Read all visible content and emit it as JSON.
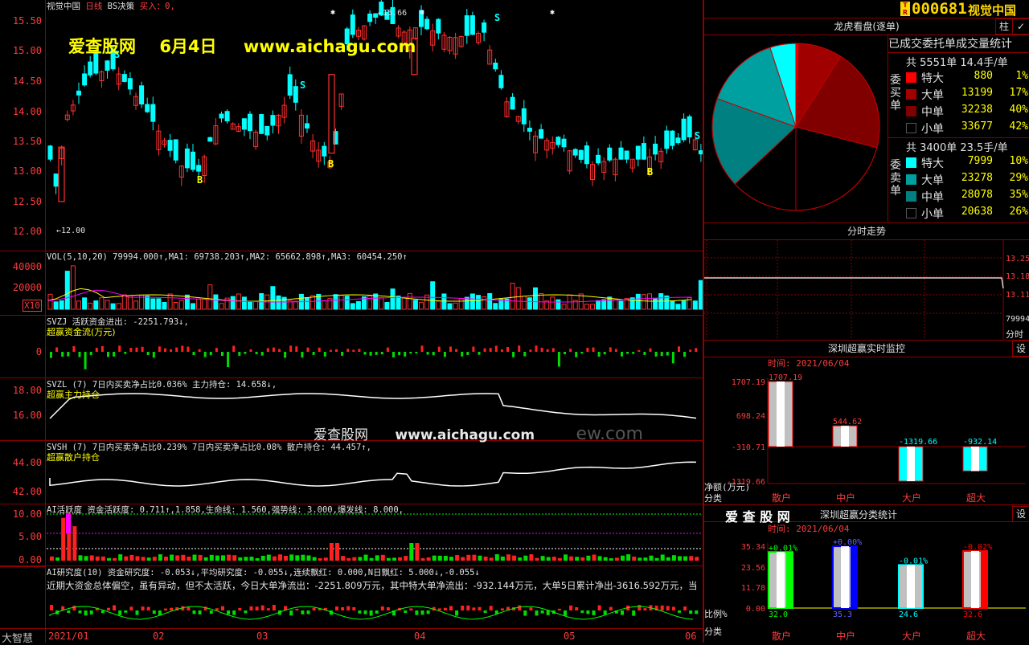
{
  "stock": {
    "code": "000681",
    "name": "视觉中国",
    "flag": "T R"
  },
  "chart_title": {
    "name": "视觉中国",
    "period": "日线",
    "strategy": "BS决策",
    "buy_label": "买入：0,"
  },
  "watermark": {
    "site": "爱查股网",
    "date": "6月4日",
    "url": "www.aichagu.com",
    "center_site": "爱查股网",
    "center_url": "www.aichagu.com",
    "center_tail": "ew.com"
  },
  "price_axis": [
    "15.50",
    "15.00",
    "14.50",
    "14.00",
    "13.50",
    "13.00",
    "12.50",
    "12.00"
  ],
  "price_marks": {
    "high": "15.66",
    "low": "12.00"
  },
  "signals": {
    "buy": "B",
    "sell": "S"
  },
  "vol": {
    "title": "VOL(5,10,20) 79994.000↑,MA1: 69738.203↑,MA2: 65662.898↑,MA3: 60454.250↑",
    "axis": [
      "40000",
      "20000"
    ],
    "unit": "X10"
  },
  "svzj": {
    "title": "SVZJ  活跃资金进出: -2251.793↓,",
    "sub": "超赢资金流(万元)",
    "axis": [
      "0"
    ]
  },
  "svzl": {
    "title": "SVZL (7) 7日内买卖净占比0.036% 主力持仓: 14.658↓,",
    "sub": "超赢主力持仓",
    "axis": [
      "18.00",
      "16.00"
    ]
  },
  "svsh": {
    "title": "SVSH (7) 7日内买卖净占比0.239% 7日内买卖净占比0.08% 散户持仓: 44.457↑,",
    "sub": "超赢散户持仓",
    "axis": [
      "44.00",
      "42.00"
    ]
  },
  "ai_active": {
    "title": "AI活跃度 资金活跃度: 0.711↑,1.858,生命线: 1.560,强势线: 3.000,爆发线: 8.000,",
    "axis": [
      "10.00",
      "5.00",
      "0.00"
    ]
  },
  "ai_research": {
    "title": "AI研究度(10) 资金研究度: -0.053↓,平均研究度: -0.055↓,连续飘红: 0.000,N日飘红: 5.000↓,-0.055↓",
    "text": "近期大资金总体偏空，虽有异动，但不太活跃，今日大单净流出：-2251.809万元，其中特大单净流出：-932.144万元，大单5日累计净出-3616.592万元，当"
  },
  "bottom_left": "大智慧",
  "date_axis": [
    "2021/01",
    "02",
    "03",
    "04",
    "05",
    "06"
  ],
  "lhb": {
    "header": "龙虎看盘(逐单)",
    "subheader": "已成交委托单成交量统计",
    "buy": {
      "label": "委买单",
      "total": "共 5551单 14.4手/单",
      "rows": [
        {
          "name": "特大",
          "value": "880",
          "pct": "1%",
          "color": "#ff0000"
        },
        {
          "name": "大单",
          "value": "13199",
          "pct": "17%",
          "color": "#a00000"
        },
        {
          "name": "中单",
          "value": "32238",
          "pct": "40%",
          "color": "#800000"
        },
        {
          "name": "小单",
          "value": "33677",
          "pct": "42%",
          "color": "#000000"
        }
      ]
    },
    "sell": {
      "label": "委卖单",
      "total": "共 3400单 23.5手/单",
      "rows": [
        {
          "name": "特大",
          "value": "7999",
          "pct": "10%",
          "color": "#00ffff"
        },
        {
          "name": "大单",
          "value": "23278",
          "pct": "29%",
          "color": "#00a0a0"
        },
        {
          "name": "中单",
          "value": "28078",
          "pct": "35%",
          "color": "#008080"
        },
        {
          "name": "小单",
          "value": "20638",
          "pct": "26%",
          "color": "#000000"
        }
      ]
    }
  },
  "pie_data": [
    1,
    17,
    40,
    42,
    26,
    35,
    29,
    10
  ],
  "intraday": {
    "header": "分时走势",
    "axis": [
      "13.25",
      "13.18",
      "13.11",
      "79994",
      "分时"
    ]
  },
  "monitor": {
    "header": "深圳超赢实时监控",
    "time": "时间: 2021/06/04",
    "settings": "设",
    "yaxis": [
      "1707.19",
      "698.24",
      "-310.71",
      "-1319.66"
    ],
    "ylabel": "净额(万元)",
    "xlabel": "分类",
    "categories": [
      "散户",
      "中户",
      "大户",
      "超大"
    ],
    "values": [
      1707.19,
      544.62,
      -1319.66,
      -932.14
    ],
    "value_labels": [
      "1707.19",
      "544.62",
      "-1319.66",
      "-932.14"
    ]
  },
  "classify": {
    "brand": "爱 查 股 网",
    "header": "深圳超赢分类统计",
    "time": "时间: 2021/06/04",
    "settings": "设",
    "yaxis": [
      "35.34",
      "23.56",
      "11.78",
      "0.00"
    ],
    "ylabel": "比例%",
    "xlabel": "分类",
    "categories": [
      "散户",
      "中户",
      "大户",
      "超大"
    ],
    "values": [
      32.0,
      35.3,
      24.6,
      32.6
    ],
    "value_labels": [
      "32.0",
      "35.3",
      "24.6",
      "32.6"
    ],
    "change_labels": [
      "+0.01%",
      "+0.00%",
      "-0.01%",
      "-0.02%"
    ],
    "colors": [
      "#00ff00",
      "#0000ff",
      "#00ffff",
      "#ff0000"
    ]
  },
  "right_top_buttons": [
    "柱",
    "✓"
  ]
}
